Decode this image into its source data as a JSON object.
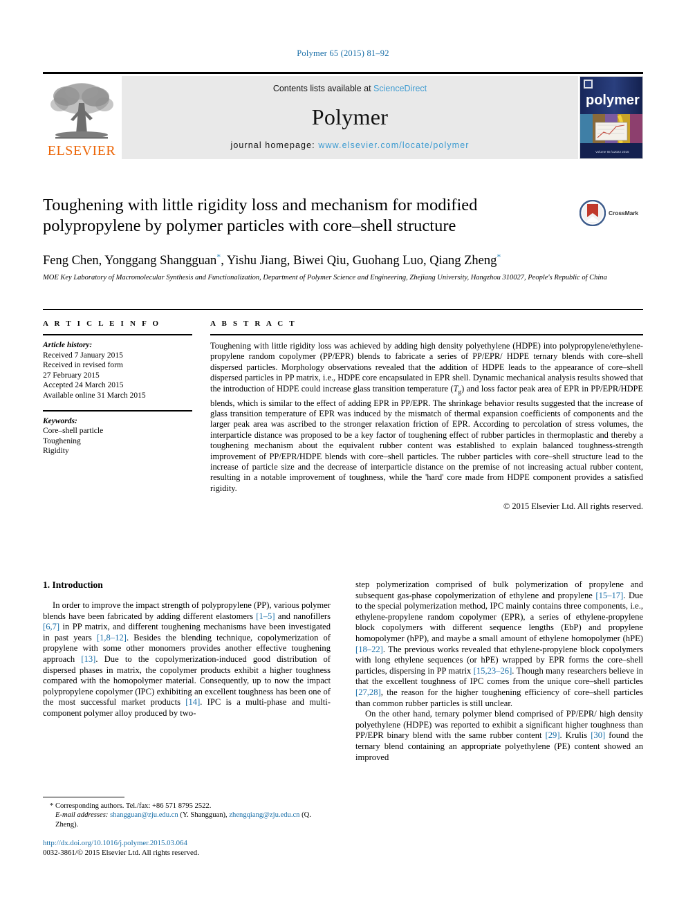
{
  "running_head": "Polymer 65 (2015) 81–92",
  "masthead": {
    "publisher_logo_text": "ELSEVIER",
    "contents_prefix": "Contents lists available at ",
    "contents_link": "ScienceDirect",
    "journal_name": "Polymer",
    "homepage_prefix": "journal homepage: ",
    "homepage_url": "www.elsevier.com/locate/polymer",
    "cover_title": "polymer",
    "cover_footer": "Volume 65 • 2015"
  },
  "article": {
    "title": "Toughening with little rigidity loss and mechanism for modified polypropylene by polymer particles with core–shell structure",
    "crossmark_label": "CrossMark",
    "authors": "Feng Chen, Yonggang Shangguan",
    "authors_part2": ", Yishu Jiang, Biwei Qiu, Guohang Luo, Qiang Zheng",
    "author_marker": "*",
    "affiliation": "MOE Key Laboratory of Macromolecular Synthesis and Functionalization, Department of Polymer Science and Engineering, Zhejiang University, Hangzhou 310027, People's Republic of China"
  },
  "article_info": {
    "heading": "A R T I C L E   I N F O",
    "history_label": "Article history:",
    "history": [
      "Received 7 January 2015",
      "Received in revised form",
      "27 February 2015",
      "Accepted 24 March 2015",
      "Available online 31 March 2015"
    ],
    "keywords_label": "Keywords:",
    "keywords": [
      "Core–shell particle",
      "Toughening",
      "Rigidity"
    ]
  },
  "abstract": {
    "heading": "A B S T R A C T",
    "text_part1": "Toughening with little rigidity loss was achieved by adding high density polyethylene (HDPE) into polypropylene/ethylene-propylene random copolymer (PP/EPR) blends to fabricate a series of PP/EPR/ HDPE ternary blends with core–shell dispersed particles. Morphology observations revealed that the addition of HDPE leads to the appearance of core–shell dispersed particles in PP matrix, i.e., HDPE core encapsulated in EPR shell. Dynamic mechanical analysis results showed that the introduction of HDPE could increase glass transition temperature (",
    "tg_symbol": "T",
    "tg_sub": "g",
    "text_part2": ") and loss factor peak area of EPR in PP/EPR/HDPE blends, which is similar to the effect of adding EPR in PP/EPR. The shrinkage behavior results suggested that the increase of glass transition temperature of EPR was induced by the mismatch of thermal expansion coefficients of components and the larger peak area was ascribed to the stronger relaxation friction of EPR. According to percolation of stress volumes, the interparticle distance was proposed to be a key factor of toughening effect of rubber particles in thermoplastic and thereby a toughening mechanism about the equivalent rubber content was established to explain balanced toughness-strength improvement of PP/EPR/HDPE blends with core–shell particles. The rubber particles with core–shell structure lead to the increase of particle size and the decrease of interparticle distance on the premise of not increasing actual rubber content, resulting in a notable improvement of toughness, while the 'hard' core made from HDPE component provides a satisfied rigidity.",
    "copyright": "© 2015 Elsevier Ltd. All rights reserved."
  },
  "introduction": {
    "heading": "1. Introduction",
    "left_p1_a": "In order to improve the impact strength of polypropylene (PP), various polymer blends have been fabricated by adding different elastomers ",
    "ref_1_5": "[1–5]",
    "left_p1_b": " and nanofillers ",
    "ref_6_7": "[6,7]",
    "left_p1_c": " in PP matrix, and different toughening mechanisms have been investigated in past years ",
    "ref_1_8_12": "[1,8–12]",
    "left_p1_d": ". Besides the blending technique, copolymerization of propylene with some other monomers provides another effective toughening approach ",
    "ref_13": "[13]",
    "left_p1_e": ". Due to the copolymerization-induced good distribution of dispersed phases in matrix, the copolymer products exhibit a higher toughness compared with the homopolymer material. Consequently, up to now the impact polypropylene copolymer (IPC) exhibiting an excellent toughness has been one of the most successful market products ",
    "ref_14": "[14]",
    "left_p1_f": ". IPC is a multi-phase and multi-component polymer alloy produced by two-",
    "right_p1_a": "step polymerization comprised of bulk polymerization of propylene and subsequent gas-phase copolymerization of ethylene and propylene ",
    "ref_15_17": "[15–17]",
    "right_p1_b": ". Due to the special polymerization method, IPC mainly contains three components, i.e., ethylene-propylene random copolymer (EPR), a series of ethylene-propylene block copolymers with different sequence lengths (EbP) and propylene homopolymer (hPP), and maybe a small amount of ethylene homopolymer (hPE) ",
    "ref_18_22": "[18–22]",
    "right_p1_c": ". The previous works revealed that ethylene-propylene block copolymers with long ethylene sequences (or hPE) wrapped by EPR forms the core–shell particles, dispersing in PP matrix ",
    "ref_15_23_26": "[15,23–26]",
    "right_p1_d": ". Though many researchers believe in that the excellent toughness of IPC comes from the unique core–shell particles ",
    "ref_27_28": "[27,28]",
    "right_p1_e": ", the reason for the higher toughening efficiency of core–shell particles than common rubber particles is still unclear.",
    "right_p2_a": "On the other hand, ternary polymer blend comprised of PP/EPR/ high density polyethylene (HDPE) was reported to exhibit a significant higher toughness than PP/EPR binary blend with the same rubber content ",
    "ref_29": "[29]",
    "right_p2_b": ". Krulis ",
    "ref_30": "[30]",
    "right_p2_c": " found the ternary blend containing an appropriate polyethylene (PE) content showed an improved"
  },
  "footnotes": {
    "corresponding": "* Corresponding authors. Tel./fax: +86 571 8795 2522.",
    "email_label": "E-mail addresses:",
    "email1": "shangguan@zju.edu.cn",
    "email1_owner": " (Y. Shangguan), ",
    "email2": "zhengqiang@zju.edu.cn",
    "email2_owner": " (Q. Zheng)."
  },
  "doi_block": {
    "doi_url": "http://dx.doi.org/10.1016/j.polymer.2015.03.064",
    "issn_line": "0032-3861/© 2015 Elsevier Ltd. All rights reserved."
  },
  "colors": {
    "link_blue": "#1a6fa8",
    "sciencedirect_blue": "#3d9bd1",
    "elsevier_orange": "#ec6608",
    "cover_navy": "#1b2d63",
    "crossmark_red": "#c0392b",
    "masthead_gray": "#e9e9e9"
  }
}
